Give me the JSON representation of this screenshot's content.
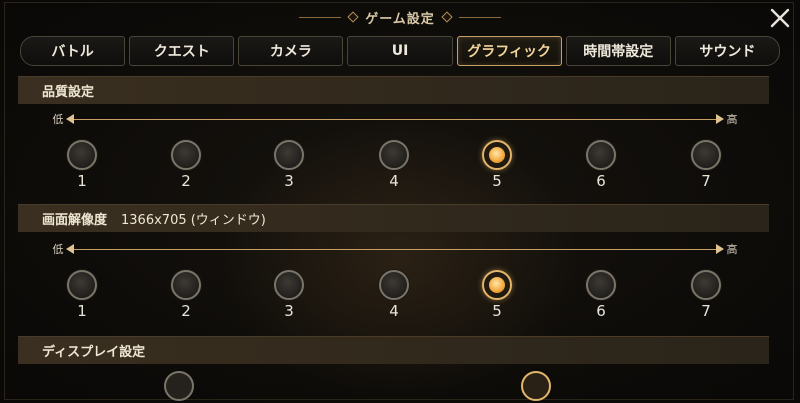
{
  "dialog": {
    "title": "ゲーム設定",
    "close_icon": "close-icon"
  },
  "tabs": [
    {
      "label": "バトル",
      "active": false
    },
    {
      "label": "クエスト",
      "active": false
    },
    {
      "label": "カメラ",
      "active": false
    },
    {
      "label": "UI",
      "active": false
    },
    {
      "label": "グラフィック",
      "active": true
    },
    {
      "label": "時間帯設定",
      "active": false
    },
    {
      "label": "サウンド",
      "active": false
    }
  ],
  "quality": {
    "header": "品質設定",
    "low_label": "低",
    "high_label": "高",
    "levels": [
      "1",
      "2",
      "3",
      "4",
      "5",
      "6",
      "7"
    ],
    "selected": "5"
  },
  "resolution": {
    "header": "画面解像度",
    "value": "1366x705 (ウィンドウ)",
    "low_label": "低",
    "high_label": "高",
    "levels": [
      "1",
      "2",
      "3",
      "4",
      "5",
      "6",
      "7"
    ],
    "selected": "5"
  },
  "display": {
    "header": "ディスプレイ設定"
  },
  "colors": {
    "accent": "#c9a064",
    "selected_dot": "#f2a63a",
    "header_bg": "#3a2f20"
  }
}
